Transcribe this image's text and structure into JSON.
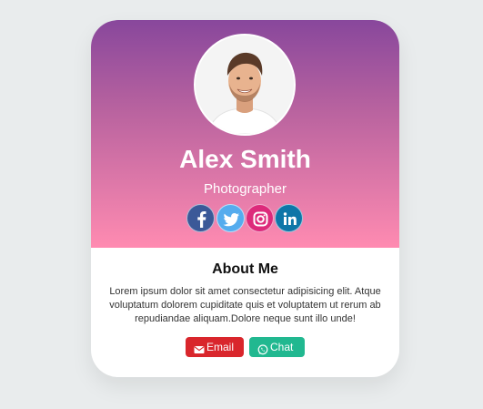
{
  "profile": {
    "name": "Alex Smith",
    "role": "Photographer"
  },
  "socials": [
    {
      "icon": "facebook-icon",
      "color": "#3b5998"
    },
    {
      "icon": "twitter-icon",
      "color": "#55acee"
    },
    {
      "icon": "instagram-icon",
      "color": "#dd2a7b"
    },
    {
      "icon": "linkedin-icon",
      "color": "#0e76a8"
    }
  ],
  "about": {
    "title": "About Me",
    "text": "Lorem ipsum dolor sit amet consectetur adipisicing elit. Atque voluptatum dolorem cupiditate quis et voluptatem ut rerum ab repudiandae aliquam.Dolore neque sunt illo unde!"
  },
  "actions": {
    "email_label": "Email",
    "chat_label": "Chat"
  },
  "colors": {
    "gradient_top": "#88479c",
    "gradient_bottom": "#ff8bb1",
    "email_button": "#d9262c",
    "chat_button": "#21b890",
    "background": "#e9eced"
  }
}
